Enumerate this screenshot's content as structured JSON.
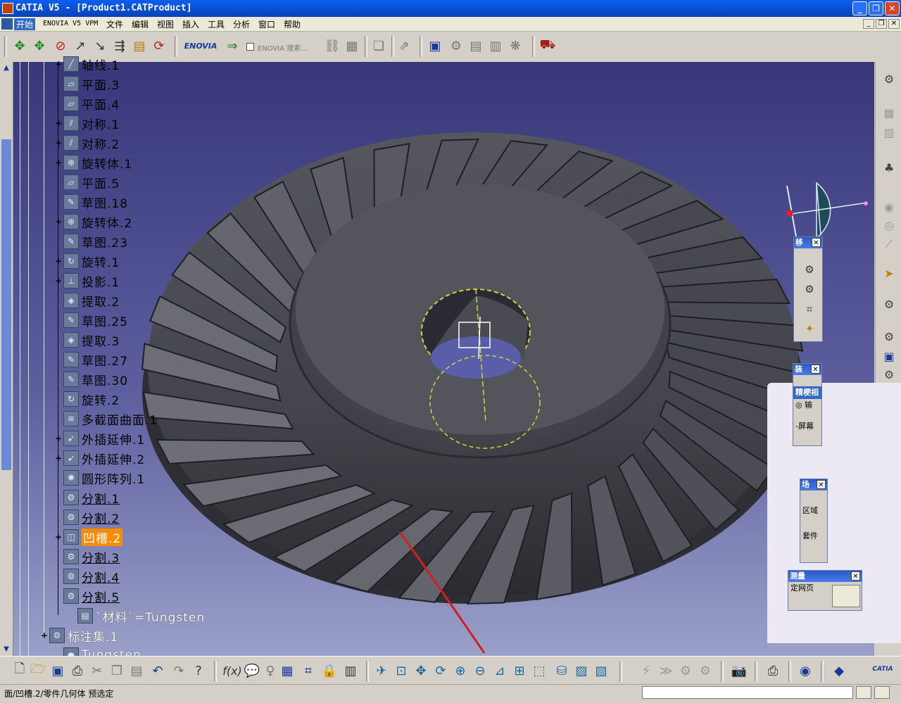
{
  "window": {
    "title": "CATIA V5 - [Product1.CATProduct]"
  },
  "menu": {
    "items": [
      "开始",
      "ENOVIA V5 VPM",
      "文件",
      "编辑",
      "视图",
      "插入",
      "工具",
      "分析",
      "窗口",
      "帮助"
    ]
  },
  "top_toolbar": {
    "enovia_search_label": "ENOVIA 搜索...",
    "icons": [
      "move-icon",
      "manipulate-icon",
      "reset-icon",
      "snap-icon",
      "explode-icon",
      "clash-icon",
      "measure-icon",
      "update-icon",
      "enovia-logo-icon",
      "search-icon"
    ]
  },
  "tree": {
    "items": [
      {
        "label": "轴线.1",
        "icon": "axis-icon"
      },
      {
        "label": "平面.3",
        "icon": "plane-icon"
      },
      {
        "label": "平面.4",
        "icon": "plane-icon"
      },
      {
        "label": "对称.1",
        "icon": "symmetry-icon"
      },
      {
        "label": "对称.2",
        "icon": "symmetry-icon"
      },
      {
        "label": "旋转体.1",
        "icon": "revolve-icon"
      },
      {
        "label": "平面.5",
        "icon": "plane-icon"
      },
      {
        "label": "草图.18",
        "icon": "sketch-icon"
      },
      {
        "label": "旋转体.2",
        "icon": "revolve-icon"
      },
      {
        "label": "草图.23",
        "icon": "sketch-icon"
      },
      {
        "label": "旋转.1",
        "icon": "rotate-icon"
      },
      {
        "label": "投影.1",
        "icon": "projection-icon"
      },
      {
        "label": "提取.2",
        "icon": "extract-icon"
      },
      {
        "label": "草图.25",
        "icon": "sketch-icon"
      },
      {
        "label": "提取.3",
        "icon": "extract-icon"
      },
      {
        "label": "草图.27",
        "icon": "sketch-icon"
      },
      {
        "label": "草图.30",
        "icon": "sketch-icon"
      },
      {
        "label": "旋转.2",
        "icon": "rotate-icon"
      },
      {
        "label": "多截面曲面.1",
        "icon": "multisection-icon"
      },
      {
        "label": "外插延伸.1",
        "icon": "extrapolate-icon"
      },
      {
        "label": "外插延伸.2",
        "icon": "extrapolate-icon"
      },
      {
        "label": "圆形阵列.1",
        "icon": "circular-pattern-icon"
      },
      {
        "label": "分割.1",
        "icon": "split-icon"
      },
      {
        "label": "分割.2",
        "icon": "split-icon"
      },
      {
        "label": "凹槽.2",
        "icon": "groove-icon"
      },
      {
        "label": "分割.3",
        "icon": "split-icon"
      },
      {
        "label": "分割.4",
        "icon": "split-icon"
      },
      {
        "label": "分割.5",
        "icon": "split-icon"
      },
      {
        "label": "`材料`=Tungsten",
        "icon": "material-icon"
      },
      {
        "label": "标注集.1",
        "icon": "annotation-set-icon"
      },
      {
        "label": "Tungsten",
        "icon": "material-sphere-icon"
      }
    ],
    "selected": "凹槽.2"
  },
  "mini_toolbars": {
    "move": {
      "title": "移"
    },
    "assembly": {
      "title": "装",
      "rows": [
        "精梗相",
        "◎ 输",
        "-屏幕"
      ]
    },
    "scene": {
      "title": "场",
      "rows": [
        "区域",
        "套件"
      ]
    },
    "measure": {
      "title": "测量",
      "rows": [
        "定网页"
      ]
    }
  },
  "statusbar": {
    "text": "面/凹槽.2/零件几何体 预选定"
  },
  "colors": {
    "title_blue": "#0842b8",
    "selection_orange": "#ff8c00",
    "viewport_top": "#37377a",
    "viewport_bottom": "#9aa0c8"
  }
}
